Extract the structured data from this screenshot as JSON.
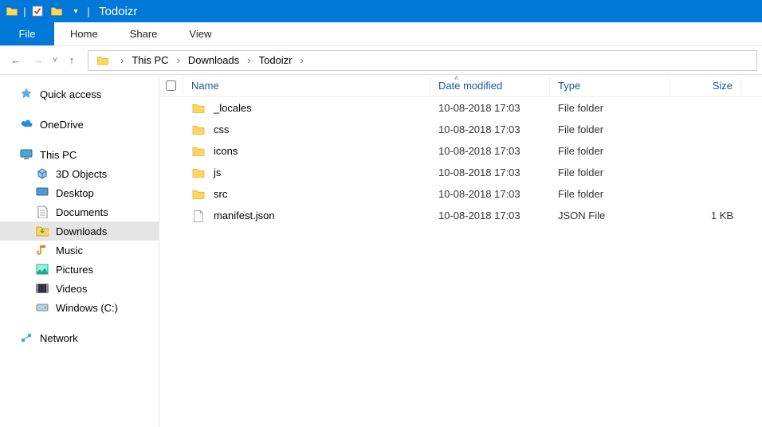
{
  "window": {
    "title": "Todoizr"
  },
  "ribbon": {
    "file": "File",
    "tabs": [
      "Home",
      "Share",
      "View"
    ]
  },
  "breadcrumb": {
    "items": [
      "This PC",
      "Downloads",
      "Todoizr"
    ]
  },
  "sidebar": {
    "quick_access": "Quick access",
    "onedrive": "OneDrive",
    "this_pc": "This PC",
    "children": [
      {
        "label": "3D Objects"
      },
      {
        "label": "Desktop"
      },
      {
        "label": "Documents"
      },
      {
        "label": "Downloads"
      },
      {
        "label": "Music"
      },
      {
        "label": "Pictures"
      },
      {
        "label": "Videos"
      },
      {
        "label": "Windows (C:)"
      }
    ],
    "network": "Network"
  },
  "columns": {
    "name": "Name",
    "date": "Date modified",
    "type": "Type",
    "size": "Size"
  },
  "rows": [
    {
      "icon": "folder",
      "name": "_locales",
      "date": "10-08-2018 17:03",
      "type": "File folder",
      "size": ""
    },
    {
      "icon": "folder",
      "name": "css",
      "date": "10-08-2018 17:03",
      "type": "File folder",
      "size": ""
    },
    {
      "icon": "folder",
      "name": "icons",
      "date": "10-08-2018 17:03",
      "type": "File folder",
      "size": ""
    },
    {
      "icon": "folder",
      "name": "js",
      "date": "10-08-2018 17:03",
      "type": "File folder",
      "size": ""
    },
    {
      "icon": "folder",
      "name": "src",
      "date": "10-08-2018 17:03",
      "type": "File folder",
      "size": ""
    },
    {
      "icon": "file",
      "name": "manifest.json",
      "date": "10-08-2018 17:03",
      "type": "JSON File",
      "size": "1 KB"
    }
  ]
}
